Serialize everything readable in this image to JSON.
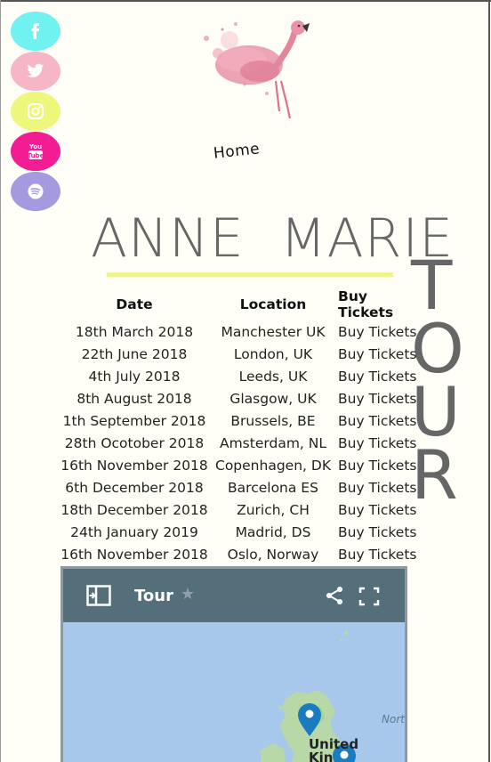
{
  "social": [
    {
      "name": "facebook",
      "icon": "facebook-icon",
      "color": "#6ff2f0"
    },
    {
      "name": "twitter",
      "icon": "twitter-icon",
      "color": "#f7b6c6"
    },
    {
      "name": "instagram",
      "icon": "instagram-icon",
      "color": "#ecf77b"
    },
    {
      "name": "youtube",
      "icon": "youtube-icon",
      "color": "#f21d92"
    },
    {
      "name": "spotify",
      "icon": "spotify-icon",
      "color": "#a59ae0"
    }
  ],
  "nav": {
    "home": "Home"
  },
  "artist": {
    "first": "ANNE",
    "last": "MARIE",
    "tour_letters": [
      "T",
      "O",
      "U",
      "R"
    ],
    "accent": "#eef58e"
  },
  "table": {
    "headers": {
      "date": "Date",
      "location": "Location",
      "tickets": "Buy Tickets"
    },
    "rows": [
      {
        "date": "18th March 2018",
        "location": "Manchester UK",
        "tickets": "Buy Tickets"
      },
      {
        "date": "22th June 2018",
        "location": "London, UK",
        "tickets": "Buy Tickets"
      },
      {
        "date": "4th July 2018",
        "location": "Leeds, UK",
        "tickets": "Buy Tickets"
      },
      {
        "date": "8th August 2018",
        "location": "Glasgow, UK",
        "tickets": "Buy Tickets"
      },
      {
        "date": "1th September 2018",
        "location": "Brussels, BE",
        "tickets": "Buy Tickets"
      },
      {
        "date": "28th Ocotober 2018",
        "location": "Amsterdam, NL",
        "tickets": "Buy Tickets"
      },
      {
        "date": "16th November 2018",
        "location": "Copenhagen, DK",
        "tickets": "Buy Tickets"
      },
      {
        "date": "6th December 2018",
        "location": "Barcelona ES",
        "tickets": "Buy Tickets"
      },
      {
        "date": "18th December 2018",
        "location": "Zurich, CH",
        "tickets": "Buy Tickets"
      },
      {
        "date": "24th January 2019",
        "location": "Madrid, DS",
        "tickets": "Buy Tickets"
      },
      {
        "date": "16th November 2018",
        "location": "Oslo, Norway",
        "tickets": "Buy Tickets"
      }
    ]
  },
  "map": {
    "title": "Tour",
    "labels": {
      "sea": "Nort",
      "country_line1": "United",
      "country_line2": "Kin"
    },
    "header_color": "#546e7a",
    "pin_color": "#1a7bbf"
  }
}
